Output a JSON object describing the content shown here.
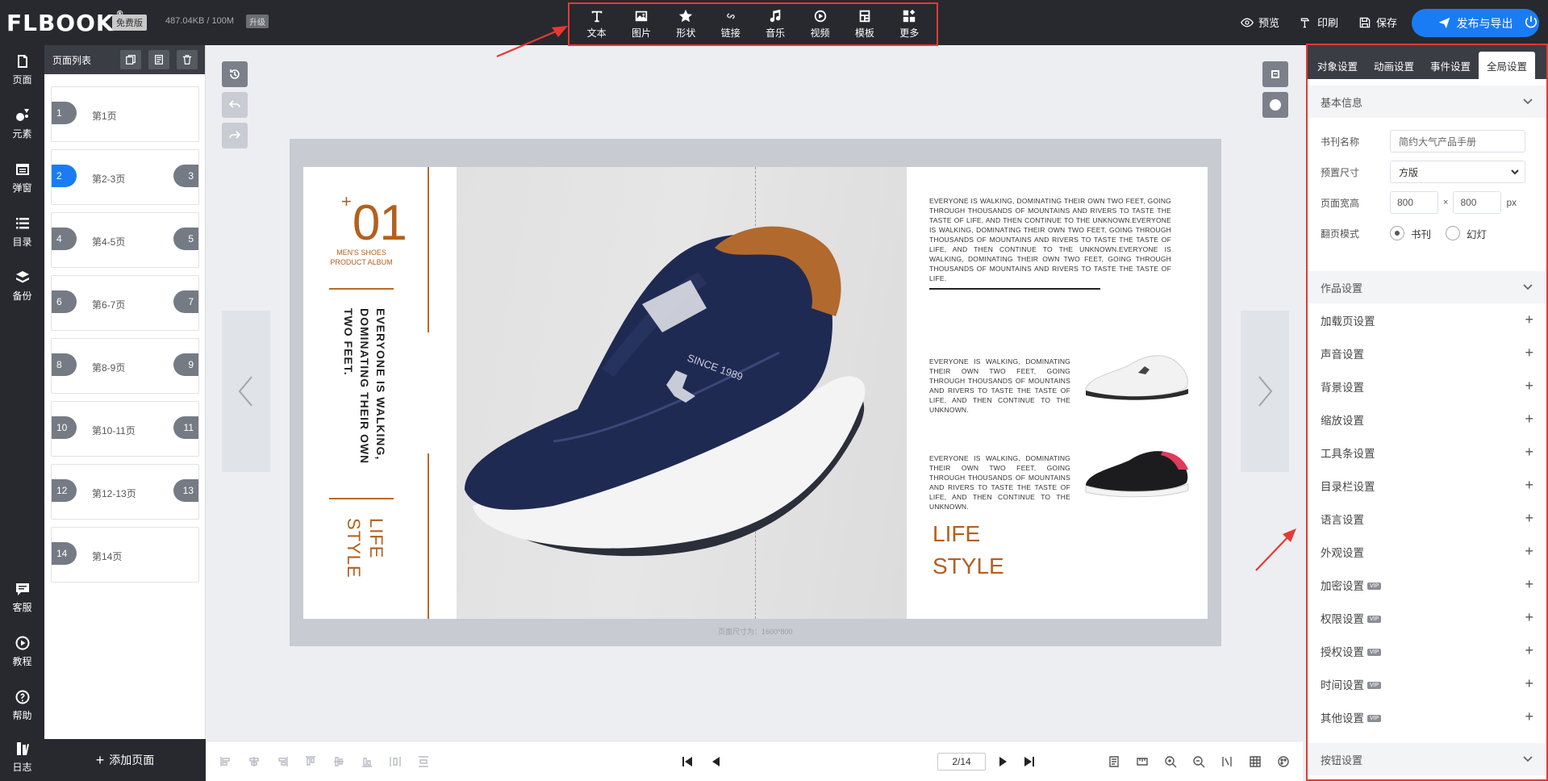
{
  "topbar": {
    "logo": "FLBOOK",
    "logo_mark": "®",
    "plan_badge": "免费版",
    "storage": "487.04KB / 100M",
    "upgrade_badge": "升级",
    "tools": [
      {
        "label": "文本",
        "icon": "text-icon"
      },
      {
        "label": "图片",
        "icon": "image-icon"
      },
      {
        "label": "形状",
        "icon": "star-icon"
      },
      {
        "label": "链接",
        "icon": "link-icon"
      },
      {
        "label": "音乐",
        "icon": "music-icon"
      },
      {
        "label": "视频",
        "icon": "video-icon"
      },
      {
        "label": "模板",
        "icon": "template-icon"
      },
      {
        "label": "更多",
        "icon": "more-icon"
      }
    ],
    "preview": "预览",
    "print": "印刷",
    "save": "保存",
    "publish": "发布与导出"
  },
  "leftnav": {
    "top": [
      {
        "label": "页面",
        "icon": "page-icon"
      },
      {
        "label": "元素",
        "icon": "elements-icon"
      },
      {
        "label": "弹窗",
        "icon": "popup-icon"
      },
      {
        "label": "目录",
        "icon": "catalog-icon"
      },
      {
        "label": "备份",
        "icon": "backup-icon"
      }
    ],
    "bottom": [
      {
        "label": "客服",
        "icon": "chat-icon"
      },
      {
        "label": "教程",
        "icon": "play-icon"
      },
      {
        "label": "帮助",
        "icon": "help-icon"
      },
      {
        "label": "日志",
        "icon": "log-icon"
      }
    ]
  },
  "pagepanel": {
    "title": "页面列表",
    "pages": [
      {
        "num": "1",
        "num2": "",
        "label": "第1页"
      },
      {
        "num": "2",
        "num2": "3",
        "label": "第2-3页",
        "active": true
      },
      {
        "num": "4",
        "num2": "5",
        "label": "第4-5页"
      },
      {
        "num": "6",
        "num2": "7",
        "label": "第6-7页"
      },
      {
        "num": "8",
        "num2": "9",
        "label": "第8-9页"
      },
      {
        "num": "10",
        "num2": "11",
        "label": "第10-11页"
      },
      {
        "num": "12",
        "num2": "13",
        "label": "第12-13页"
      },
      {
        "num": "14",
        "num2": "",
        "label": "第14页"
      }
    ],
    "add_page": "添加页面"
  },
  "canvas": {
    "page_size_note": "页面尺寸为：1600*800",
    "left_page": {
      "plus": "+",
      "number": "01",
      "subtitle1": "MEN'S SHOES",
      "subtitle2": "PRODUCT ALBUM",
      "vertical_text": "EVERYONE IS WALKING, DOMINATING THEIR OWN TWO FEET.",
      "vertical_life": "LIFE STYLE"
    },
    "shoe_brand": "SINCE 1989",
    "right_page": {
      "para1": "EVERYONE IS WALKING, DOMINATING THEIR OWN TWO FEET, GOING THROUGH THOUSANDS OF MOUNTAINS AND RIVERS TO TASTE THE TASTE OF LIFE, AND THEN CONTINUE TO THE UNKNOWN.EVERYONE IS WALKING, DOMINATING THEIR OWN TWO FEET, GOING THROUGH THOUSANDS OF MOUNTAINS AND RIVERS TO TASTE THE TASTE OF LIFE, AND THEN CONTINUE TO THE UNKNOWN.EVERYONE IS WALKING, DOMINATING THEIR OWN TWO FEET, GOING THROUGH THOUSANDS OF MOUNTAINS AND RIVERS TO TASTE THE TASTE OF LIFE.",
      "para2": "EVERYONE IS WALKING, DOMINATING THEIR OWN TWO FEET, GOING THROUGH THOUSANDS OF MOUNTAINS AND RIVERS TO TASTE THE TASTE OF LIFE, AND THEN CONTINUE TO THE UNKNOWN.",
      "para3": "EVERYONE IS WALKING, DOMINATING THEIR OWN TWO FEET, GOING THROUGH THOUSANDS OF MOUNTAINS AND RIVERS TO TASTE THE TASTE OF LIFE, AND THEN CONTINUE TO THE UNKNOWN.",
      "lifestyle1": "LIFE",
      "lifestyle2": "STYLE"
    }
  },
  "bottombar": {
    "page_indicator": "2/14"
  },
  "rightpanel": {
    "tabs": [
      {
        "label": "对象设置"
      },
      {
        "label": "动画设置"
      },
      {
        "label": "事件设置"
      },
      {
        "label": "全局设置",
        "active": true
      }
    ],
    "basic_info": {
      "title": "基本信息",
      "book_name_label": "书刊名称",
      "book_name_placeholder": "简约大气产品手册",
      "preset_size_label": "预置尺寸",
      "preset_size_value": "方版",
      "page_size_label": "页面宽高",
      "width": "800",
      "height": "800",
      "times": "×",
      "unit": "px",
      "flip_mode_label": "翻页模式",
      "mode_book": "书刊",
      "mode_slide": "幻灯"
    },
    "work_settings": {
      "title": "作品设置",
      "items": [
        {
          "label": "加载页设置",
          "vip": false
        },
        {
          "label": "声音设置",
          "vip": false
        },
        {
          "label": "背景设置",
          "vip": false
        },
        {
          "label": "缩放设置",
          "vip": false
        },
        {
          "label": "工具条设置",
          "vip": false
        },
        {
          "label": "目录栏设置",
          "vip": false
        },
        {
          "label": "语言设置",
          "vip": false
        },
        {
          "label": "外观设置",
          "vip": false
        },
        {
          "label": "加密设置",
          "vip": true
        },
        {
          "label": "权限设置",
          "vip": true
        },
        {
          "label": "授权设置",
          "vip": true
        },
        {
          "label": "时间设置",
          "vip": true
        },
        {
          "label": "其他设置",
          "vip": true
        }
      ],
      "vip_label": "VIP",
      "plus": "+"
    },
    "button_settings": {
      "title": "按钮设置"
    }
  },
  "colors": {
    "accent": "#1a7cf5",
    "dark": "#27292e",
    "brand_brown": "#b2601e",
    "highlight_red": "#e53935"
  }
}
